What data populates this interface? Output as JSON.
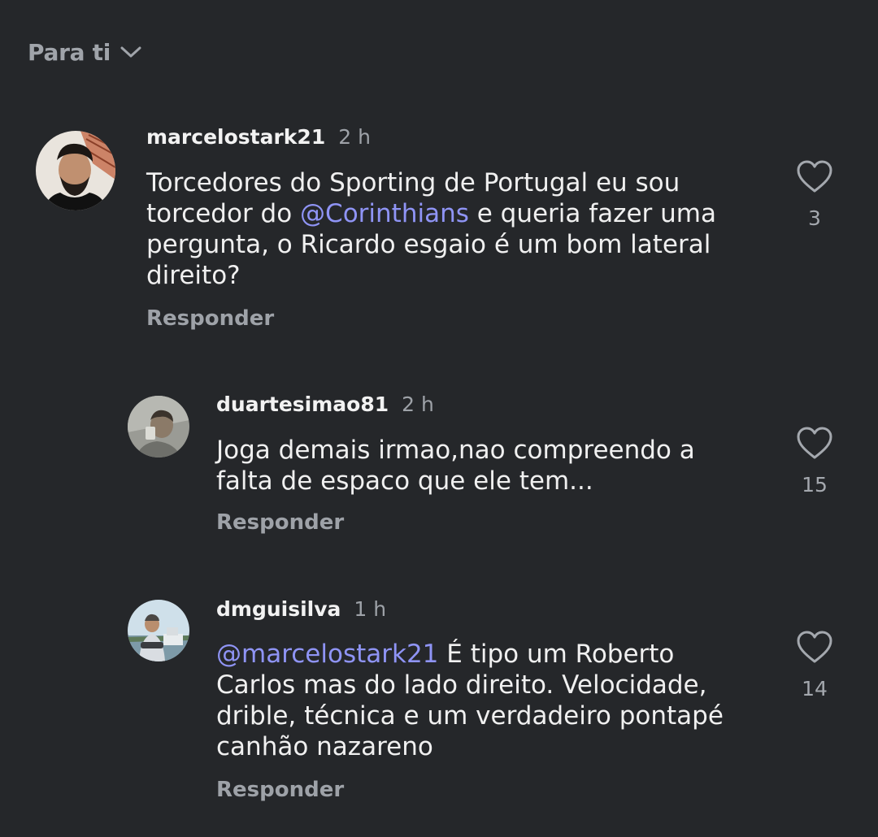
{
  "header": {
    "title": "Para ti"
  },
  "comments": [
    {
      "username": "marcelostark21",
      "time": "2 h",
      "lines": [
        {
          "pre": "Torcedores do Sporting de Portugal eu sou",
          "mention": "",
          "post": ""
        },
        {
          "pre": "torcedor do ",
          "mention": "@Corinthians",
          "post": " e queria fazer uma"
        },
        {
          "pre": "pergunta, o Ricardo esgaio é um bom lateral",
          "mention": "",
          "post": ""
        },
        {
          "pre": "direito?",
          "mention": "",
          "post": ""
        }
      ],
      "reply_label": "Responder",
      "likes": "3"
    },
    {
      "username": "duartesimao81",
      "time": "2 h",
      "lines": [
        {
          "pre": "Joga demais irmao,nao compreendo a",
          "mention": "",
          "post": ""
        },
        {
          "pre": "falta de espaco que ele tem...",
          "mention": "",
          "post": ""
        }
      ],
      "reply_label": "Responder",
      "likes": "15"
    },
    {
      "username": "dmguisilva",
      "time": "1 h",
      "lines": [
        {
          "pre": "",
          "mention": "@marcelostark21",
          "post": " É tipo um Roberto"
        },
        {
          "pre": "Carlos mas do lado direito. Velocidade,",
          "mention": "",
          "post": ""
        },
        {
          "pre": "drible, técnica e um verdadeiro pontapé",
          "mention": "",
          "post": ""
        },
        {
          "pre": "canhão nazareno",
          "mention": "",
          "post": ""
        }
      ],
      "reply_label": "Responder",
      "likes": "14"
    }
  ],
  "icons": {
    "header_chevron": "chevron-down-icon",
    "like": "heart-icon",
    "mention": "threads-at-icon"
  },
  "colors": {
    "background": "#25272a",
    "text": "#f0f0f0",
    "secondary": "#9ea2a8",
    "mention": "#8f94f5"
  }
}
